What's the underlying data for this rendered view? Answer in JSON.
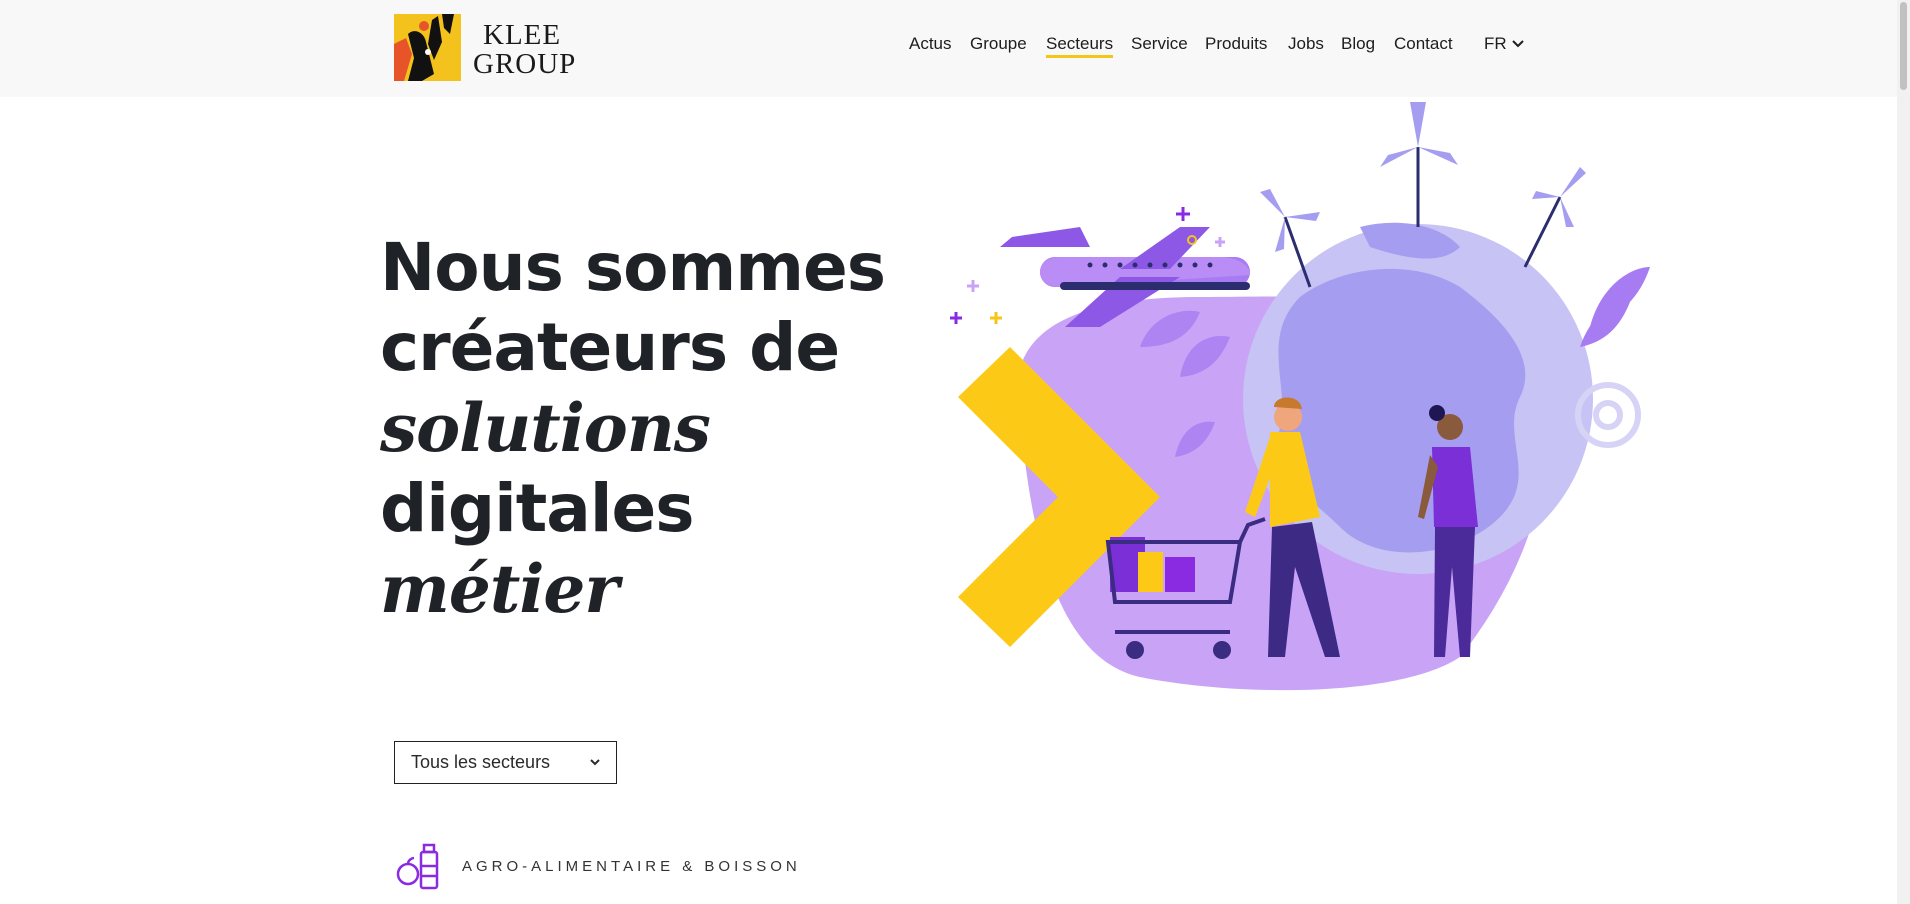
{
  "brand": {
    "line1": "KLEE",
    "line2": "GROUP"
  },
  "nav": {
    "items": [
      {
        "label": "Actus"
      },
      {
        "label": "Groupe"
      },
      {
        "label": "Secteurs"
      },
      {
        "label": "Service"
      },
      {
        "label": "Produits"
      },
      {
        "label": "Jobs"
      },
      {
        "label": "Blog"
      },
      {
        "label": "Contact"
      }
    ],
    "active": "Secteurs",
    "lang": "FR"
  },
  "hero": {
    "line1": "Nous sommes",
    "line2": "créateurs de",
    "line3_italic": "solutions",
    "line4": "digitales",
    "line4_italic": "métier"
  },
  "filter": {
    "selected": "Tous les secteurs"
  },
  "sectors": [
    {
      "label": "AGRO-ALIMENTAIRE & BOISSON",
      "icon": "food-drink-icon"
    }
  ],
  "colors": {
    "accent": "#f5c518",
    "purple": "#a77cf2",
    "dark": "#1f2227"
  }
}
